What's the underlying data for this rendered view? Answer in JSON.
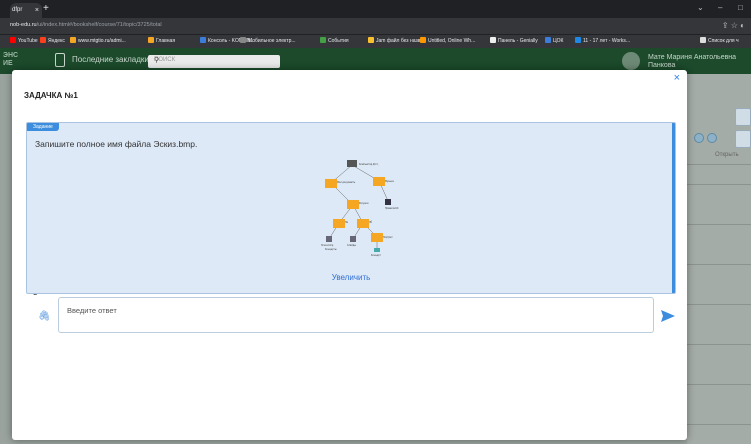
{
  "browser": {
    "tab_title": "dfpr",
    "tab_close": "×",
    "new_tab": "+",
    "url_domain": "nob-edu.ru",
    "url_path": "/ui/index.html#/bookshelf/course/71/topic/3725/total",
    "window_controls": [
      "⌄",
      "–",
      "□"
    ],
    "bookmarks": [
      {
        "label": "YouTube",
        "color": "#ff0000"
      },
      {
        "label": "Яндекс",
        "color": "#fc3f1d"
      },
      {
        "label": "www.mtgtio.ru/admi...",
        "color": "#f5a623"
      },
      {
        "label": "Главная",
        "color": "#f5a623"
      },
      {
        "label": "Консоль - KONTIN...",
        "color": "#3b7ddd"
      },
      {
        "label": "Мобильное электр...",
        "color": "#888888"
      },
      {
        "label": "События",
        "color": "#43a047"
      },
      {
        "label": "Jam файл без назв...",
        "color": "#fbc02d"
      },
      {
        "label": "Untitled, Online Wh...",
        "color": "#ff9800"
      },
      {
        "label": "Панель - Genially",
        "color": "#eeeeee"
      },
      {
        "label": "ЦОК",
        "color": "#3b7ddd"
      },
      {
        "label": "11 - 17 лет - Works...",
        "color": "#1e88e5"
      },
      {
        "label": "Список для ч",
        "color": "#dddddd"
      }
    ]
  },
  "site": {
    "logo": "ЭНС\nИЕ",
    "last_bookmarks": "Последние закладки",
    "search_placeholder": "ПОИСК",
    "user_name": "Мате Мариня Анатольевна\nПанкова",
    "bg_column": "Открыть"
  },
  "modal": {
    "title": "ЗАДАЧКА №1",
    "close": "×",
    "task_label": "Задание",
    "task_text": "Запишите полное имя файла Эскиз.bmp.",
    "zoom_link": "Увеличить",
    "tree_labels": [
      "Компьютер Д:С:\\",
      "Мои документы",
      "Музыка",
      "Рисунки",
      "Правила.txt",
      "Нв",
      "Лб",
      "Эскиз.bmp",
      "Слайды",
      "Портрет",
      "Концерты",
      "Концерт"
    ],
    "answer_placeholder": "Введите ответ",
    "cut_text": "Для выбо"
  }
}
